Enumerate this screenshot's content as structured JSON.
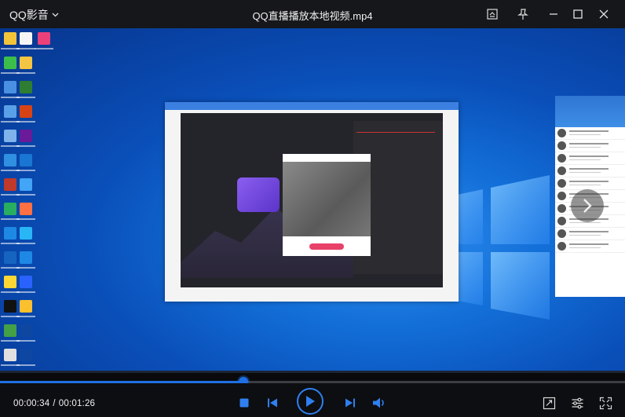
{
  "titlebar": {
    "app_name": "QQ影音",
    "file_title": "QQ直播播放本地视频.mp4"
  },
  "playback": {
    "current_time": "00:00:34",
    "separator": "/",
    "total_time": "00:01:26",
    "progress_fraction": 0.39
  },
  "colors": {
    "accent": "#1e6fe3",
    "titlebar_bg": "#16171a",
    "controls_bg": "#0d0e11"
  },
  "icons": {
    "app_menu": "chevron-down-icon",
    "screenshot": "screenshot-icon",
    "pin": "pin-icon",
    "minimize": "minimize-icon",
    "maximize": "maximize-icon",
    "close": "close-icon",
    "stop": "stop-icon",
    "previous": "skip-previous-icon",
    "play": "play-icon",
    "next": "skip-next-icon",
    "volume": "volume-icon",
    "capture": "capture-icon",
    "settings": "settings-sliders-icon",
    "fullscreen": "fullscreen-icon"
  }
}
